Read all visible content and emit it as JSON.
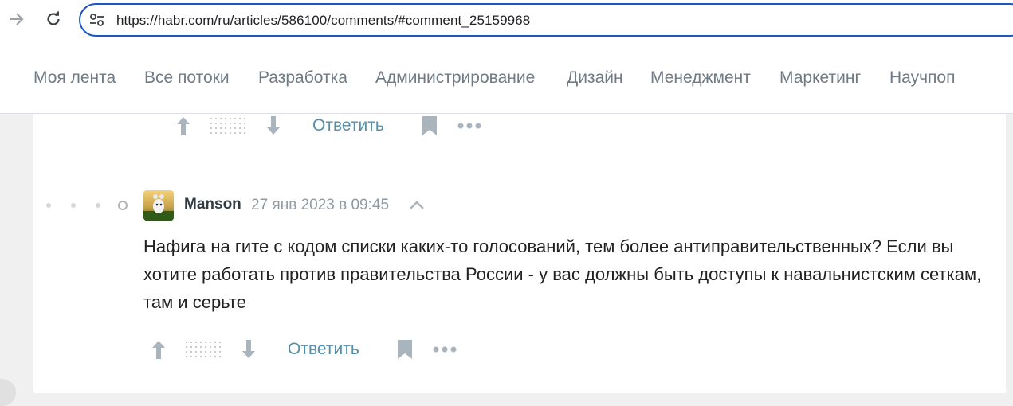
{
  "browser": {
    "url": "https://habr.com/ru/articles/586100/comments/#comment_25159968",
    "back_icon": "arrow-left-icon",
    "reload_icon": "reload-icon",
    "site_info_icon": "tune-icon"
  },
  "nav": {
    "items": [
      "Моя лента",
      "Все потоки",
      "Разработка",
      "Администрирование",
      "Дизайн",
      "Менеджмент",
      "Маркетинг",
      "Научпоп"
    ]
  },
  "comments": [
    {
      "reply_label": "Ответить"
    },
    {
      "author": "Manson",
      "timestamp": "27 янв 2023 в 09:45",
      "body": "Нафига на гите с кодом списки каких-то голосований, тем более антиправительственных? Если вы хотите работать против правительства России - у вас должны быть доступы к навальнистским сеткам, там и серьте",
      "reply_label": "Ответить"
    }
  ],
  "colors": {
    "accent_link": "#548eaa",
    "url_focus": "#1a56c9",
    "nav_text": "#707a85",
    "icon_gray": "#a9b4bd"
  }
}
